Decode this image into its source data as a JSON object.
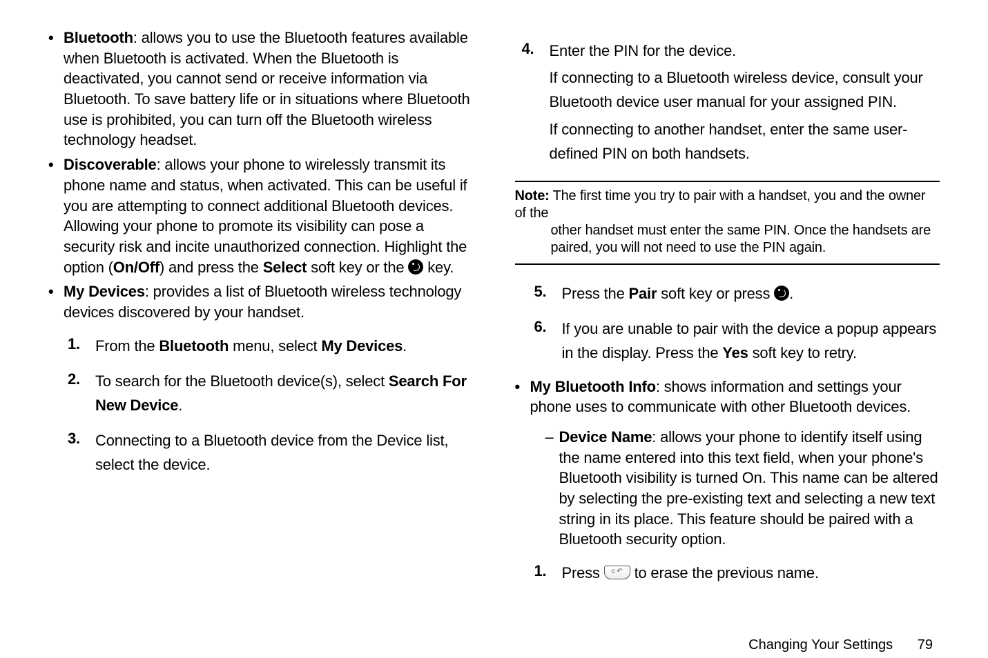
{
  "left": {
    "bullets": [
      {
        "lead": "Bluetooth",
        "rest": ": allows you to use the Bluetooth features available when Bluetooth is activated. When the Bluetooth is deactivated, you cannot send or receive information via Bluetooth. To save battery life or in situations where Bluetooth use is prohibited, you can turn off the Bluetooth wireless technology headset."
      },
      {
        "lead": "Discoverable",
        "rest_a": ": allows your phone to wirelessly transmit its phone name and status, when activated. This can be useful if you are attempting to connect additional Bluetooth devices. Allowing your phone to promote its visibility can pose a security risk and incite unauthorized connection. Highlight the option (",
        "onoff": "On/Off",
        "rest_b": ") and press the ",
        "select": "Select",
        "rest_c": " soft key or the ",
        "rest_d": " key."
      },
      {
        "lead": "My Devices",
        "rest": ": provides a list of Bluetooth wireless technology devices discovered by your handset."
      }
    ],
    "numbered": [
      {
        "num": "1.",
        "pre": "From the ",
        "b1": "Bluetooth",
        "mid": " menu, select ",
        "b2": "My Devices",
        "post": "."
      },
      {
        "num": "2.",
        "pre": "To search for the Bluetooth device(s), select ",
        "b1": "Search For New Device",
        "post": "."
      },
      {
        "num": "3.",
        "pre": "Connecting to a Bluetooth device from the Device list, select the device."
      }
    ]
  },
  "right": {
    "step4": {
      "num": "4.",
      "line1": "Enter the PIN for the device.",
      "line2": "If connecting to a Bluetooth wireless device, consult your Bluetooth device user manual for your assigned PIN.",
      "line3": "If connecting to another handset, enter the same user-defined PIN on both handsets."
    },
    "note": {
      "lead": "Note:",
      "body": " The first time you try to pair with a handset, you and the owner of the other handset must enter the same PIN. Once the handsets are paired, you will not need to use the PIN again."
    },
    "step5": {
      "num": "5.",
      "pre": "Press the ",
      "b1": "Pair",
      "mid": " soft key or press ",
      "post": "."
    },
    "step6": {
      "num": "6.",
      "pre": "If you are unable to pair with the device a popup appears in the display. Press the ",
      "b1": "Yes",
      "post": " soft key to retry."
    },
    "mybt": {
      "lead": "My Bluetooth Info",
      "rest": ": shows information and settings your phone uses to communicate with other Bluetooth devices."
    },
    "devname": {
      "lead": "Device Name",
      "rest": ": allows your phone to identify itself using the name entered into this text field, when your phone's Bluetooth visibility is turned On. This name can be altered by selecting the pre-existing text and selecting a new text string in its place. This feature should be paired with a Bluetooth security option."
    },
    "step1b": {
      "num": "1.",
      "pre": "Press ",
      "post": " to erase the previous name."
    }
  },
  "footer": {
    "section": "Changing Your Settings",
    "page": "79"
  },
  "icons": {
    "clear_key": "c ↶"
  }
}
